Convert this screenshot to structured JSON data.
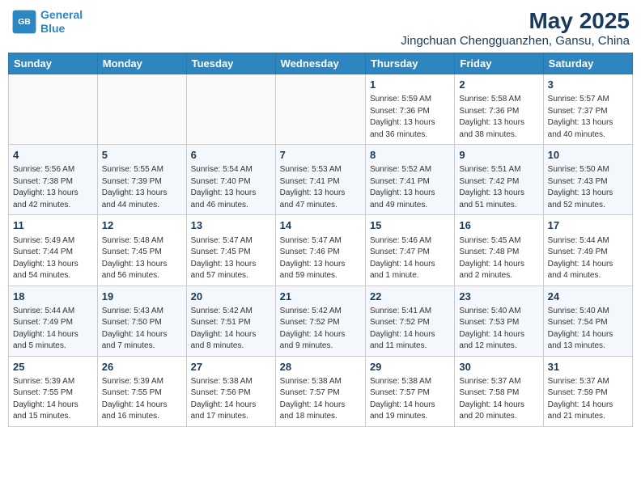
{
  "header": {
    "logo_line1": "General",
    "logo_line2": "Blue",
    "month_title": "May 2025",
    "location": "Jingchuan Chengguanzhen, Gansu, China"
  },
  "days_of_week": [
    "Sunday",
    "Monday",
    "Tuesday",
    "Wednesday",
    "Thursday",
    "Friday",
    "Saturday"
  ],
  "weeks": [
    [
      {
        "day": "",
        "info": ""
      },
      {
        "day": "",
        "info": ""
      },
      {
        "day": "",
        "info": ""
      },
      {
        "day": "",
        "info": ""
      },
      {
        "day": "1",
        "info": "Sunrise: 5:59 AM\nSunset: 7:36 PM\nDaylight: 13 hours\nand 36 minutes."
      },
      {
        "day": "2",
        "info": "Sunrise: 5:58 AM\nSunset: 7:36 PM\nDaylight: 13 hours\nand 38 minutes."
      },
      {
        "day": "3",
        "info": "Sunrise: 5:57 AM\nSunset: 7:37 PM\nDaylight: 13 hours\nand 40 minutes."
      }
    ],
    [
      {
        "day": "4",
        "info": "Sunrise: 5:56 AM\nSunset: 7:38 PM\nDaylight: 13 hours\nand 42 minutes."
      },
      {
        "day": "5",
        "info": "Sunrise: 5:55 AM\nSunset: 7:39 PM\nDaylight: 13 hours\nand 44 minutes."
      },
      {
        "day": "6",
        "info": "Sunrise: 5:54 AM\nSunset: 7:40 PM\nDaylight: 13 hours\nand 46 minutes."
      },
      {
        "day": "7",
        "info": "Sunrise: 5:53 AM\nSunset: 7:41 PM\nDaylight: 13 hours\nand 47 minutes."
      },
      {
        "day": "8",
        "info": "Sunrise: 5:52 AM\nSunset: 7:41 PM\nDaylight: 13 hours\nand 49 minutes."
      },
      {
        "day": "9",
        "info": "Sunrise: 5:51 AM\nSunset: 7:42 PM\nDaylight: 13 hours\nand 51 minutes."
      },
      {
        "day": "10",
        "info": "Sunrise: 5:50 AM\nSunset: 7:43 PM\nDaylight: 13 hours\nand 52 minutes."
      }
    ],
    [
      {
        "day": "11",
        "info": "Sunrise: 5:49 AM\nSunset: 7:44 PM\nDaylight: 13 hours\nand 54 minutes."
      },
      {
        "day": "12",
        "info": "Sunrise: 5:48 AM\nSunset: 7:45 PM\nDaylight: 13 hours\nand 56 minutes."
      },
      {
        "day": "13",
        "info": "Sunrise: 5:47 AM\nSunset: 7:45 PM\nDaylight: 13 hours\nand 57 minutes."
      },
      {
        "day": "14",
        "info": "Sunrise: 5:47 AM\nSunset: 7:46 PM\nDaylight: 13 hours\nand 59 minutes."
      },
      {
        "day": "15",
        "info": "Sunrise: 5:46 AM\nSunset: 7:47 PM\nDaylight: 14 hours\nand 1 minute."
      },
      {
        "day": "16",
        "info": "Sunrise: 5:45 AM\nSunset: 7:48 PM\nDaylight: 14 hours\nand 2 minutes."
      },
      {
        "day": "17",
        "info": "Sunrise: 5:44 AM\nSunset: 7:49 PM\nDaylight: 14 hours\nand 4 minutes."
      }
    ],
    [
      {
        "day": "18",
        "info": "Sunrise: 5:44 AM\nSunset: 7:49 PM\nDaylight: 14 hours\nand 5 minutes."
      },
      {
        "day": "19",
        "info": "Sunrise: 5:43 AM\nSunset: 7:50 PM\nDaylight: 14 hours\nand 7 minutes."
      },
      {
        "day": "20",
        "info": "Sunrise: 5:42 AM\nSunset: 7:51 PM\nDaylight: 14 hours\nand 8 minutes."
      },
      {
        "day": "21",
        "info": "Sunrise: 5:42 AM\nSunset: 7:52 PM\nDaylight: 14 hours\nand 9 minutes."
      },
      {
        "day": "22",
        "info": "Sunrise: 5:41 AM\nSunset: 7:52 PM\nDaylight: 14 hours\nand 11 minutes."
      },
      {
        "day": "23",
        "info": "Sunrise: 5:40 AM\nSunset: 7:53 PM\nDaylight: 14 hours\nand 12 minutes."
      },
      {
        "day": "24",
        "info": "Sunrise: 5:40 AM\nSunset: 7:54 PM\nDaylight: 14 hours\nand 13 minutes."
      }
    ],
    [
      {
        "day": "25",
        "info": "Sunrise: 5:39 AM\nSunset: 7:55 PM\nDaylight: 14 hours\nand 15 minutes."
      },
      {
        "day": "26",
        "info": "Sunrise: 5:39 AM\nSunset: 7:55 PM\nDaylight: 14 hours\nand 16 minutes."
      },
      {
        "day": "27",
        "info": "Sunrise: 5:38 AM\nSunset: 7:56 PM\nDaylight: 14 hours\nand 17 minutes."
      },
      {
        "day": "28",
        "info": "Sunrise: 5:38 AM\nSunset: 7:57 PM\nDaylight: 14 hours\nand 18 minutes."
      },
      {
        "day": "29",
        "info": "Sunrise: 5:38 AM\nSunset: 7:57 PM\nDaylight: 14 hours\nand 19 minutes."
      },
      {
        "day": "30",
        "info": "Sunrise: 5:37 AM\nSunset: 7:58 PM\nDaylight: 14 hours\nand 20 minutes."
      },
      {
        "day": "31",
        "info": "Sunrise: 5:37 AM\nSunset: 7:59 PM\nDaylight: 14 hours\nand 21 minutes."
      }
    ]
  ]
}
